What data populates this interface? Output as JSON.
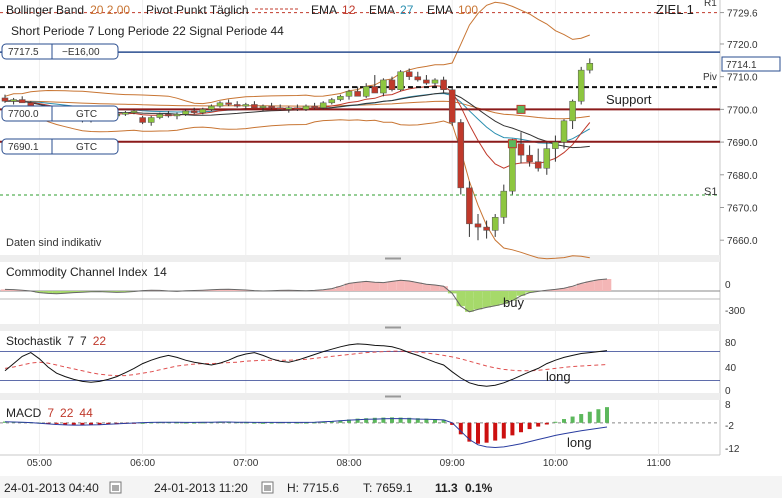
{
  "header": {
    "indicators": [
      {
        "name": "Bollinger Band",
        "params": "20  2.00",
        "color": "#c87533"
      },
      {
        "name": "Pivot Punkt  Täglich",
        "params": "",
        "color": "#c0392b"
      },
      {
        "name": "EMA",
        "params": "12",
        "color": "#c0392b"
      },
      {
        "name": "EMA",
        "params": "27",
        "color": "#2a8fb0"
      },
      {
        "name": "EMA",
        "params": "100",
        "color": "#c87533"
      }
    ],
    "target_label": "ZIEL 1",
    "trend_line": "Short Periode  7    Long Periode  22    Signal Periode  44",
    "disclaimer": "Daten sind indikativ"
  },
  "orders": [
    {
      "price": "7717.5",
      "action": "−E16,00",
      "color": "#2a4d8f"
    },
    {
      "price": "7700.0",
      "action": "GTC",
      "color": "#2a4d8f"
    },
    {
      "price": "7690.1",
      "action": "GTC",
      "color": "#2a4d8f"
    }
  ],
  "annotations": {
    "support": "Support",
    "buy": "buy",
    "long_stoch": "long",
    "long_macd": "long",
    "piv": "Piv",
    "s1": "S1",
    "r1": "R1",
    "last_price": "7714.1"
  },
  "panels": {
    "cci": {
      "title": "Commodity Channel Index",
      "param": "14",
      "ticks": [
        "0",
        "-300"
      ]
    },
    "stoch": {
      "title": "Stochastik",
      "params": [
        "7",
        "7",
        "22"
      ],
      "ticks": [
        "80",
        "40",
        "0"
      ]
    },
    "macd": {
      "title": "MACD",
      "params": [
        "7",
        "22",
        "44"
      ],
      "ticks": [
        "8",
        "-2",
        "-12"
      ]
    }
  },
  "footer": {
    "from": "24-01-2013 04:40",
    "to": "24-01-2013 11:20",
    "high": "H: 7715.6",
    "low": "T: 7659.1",
    "change": "11.3",
    "change_pct": "0.1%"
  },
  "chart_data": {
    "type": "candlestick",
    "x_ticks": [
      "05:00",
      "06:00",
      "07:00",
      "08:00",
      "09:00",
      "10:00",
      "11:00"
    ],
    "y_ticks": [
      7729.6,
      7720.0,
      7710.0,
      7700.0,
      7690.0,
      7680.0,
      7670.0,
      7660.0
    ],
    "ylim": [
      7657,
      7731
    ],
    "levels": {
      "r1": 7729.6,
      "order_high": 7717.5,
      "pivot": 7706.8,
      "support": 7700.0,
      "order_low": 7690.1,
      "s1": 7673.8
    },
    "candles": [
      {
        "t": "04:40",
        "o": 7703.5,
        "h": 7704.5,
        "l": 7702.0,
        "c": 7702.5
      },
      {
        "t": "04:45",
        "o": 7702.5,
        "h": 7703.5,
        "l": 7701.5,
        "c": 7703.0
      },
      {
        "t": "04:50",
        "o": 7703.0,
        "h": 7704.0,
        "l": 7702.0,
        "c": 7702.0
      },
      {
        "t": "04:55",
        "o": 7702.0,
        "h": 7702.5,
        "l": 7700.0,
        "c": 7700.5
      },
      {
        "t": "05:00",
        "o": 7700.5,
        "h": 7701.0,
        "l": 7698.5,
        "c": 7699.5
      },
      {
        "t": "05:05",
        "o": 7699.5,
        "h": 7700.5,
        "l": 7698.0,
        "c": 7698.5
      },
      {
        "t": "05:10",
        "o": 7698.5,
        "h": 7699.5,
        "l": 7697.5,
        "c": 7698.0
      },
      {
        "t": "05:15",
        "o": 7698.0,
        "h": 7699.0,
        "l": 7697.0,
        "c": 7697.5
      },
      {
        "t": "05:20",
        "o": 7697.5,
        "h": 7698.5,
        "l": 7696.5,
        "c": 7697.0
      },
      {
        "t": "05:25",
        "o": 7697.0,
        "h": 7698.0,
        "l": 7696.0,
        "c": 7696.5
      },
      {
        "t": "05:30",
        "o": 7696.5,
        "h": 7697.5,
        "l": 7696.0,
        "c": 7697.0
      },
      {
        "t": "05:35",
        "o": 7697.0,
        "h": 7698.0,
        "l": 7696.5,
        "c": 7697.5
      },
      {
        "t": "05:40",
        "o": 7697.5,
        "h": 7698.5,
        "l": 7697.0,
        "c": 7698.0
      },
      {
        "t": "05:45",
        "o": 7698.0,
        "h": 7699.0,
        "l": 7697.5,
        "c": 7698.5
      },
      {
        "t": "05:50",
        "o": 7698.5,
        "h": 7699.5,
        "l": 7698.0,
        "c": 7699.0
      },
      {
        "t": "05:55",
        "o": 7699.0,
        "h": 7700.0,
        "l": 7698.5,
        "c": 7699.5
      },
      {
        "t": "06:00",
        "o": 7697.5,
        "h": 7698.0,
        "l": 7695.5,
        "c": 7696.0
      },
      {
        "t": "06:05",
        "o": 7696.0,
        "h": 7698.0,
        "l": 7695.0,
        "c": 7697.5
      },
      {
        "t": "06:10",
        "o": 7697.5,
        "h": 7699.0,
        "l": 7697.0,
        "c": 7698.5
      },
      {
        "t": "06:15",
        "o": 7698.5,
        "h": 7699.5,
        "l": 7697.5,
        "c": 7698.0
      },
      {
        "t": "06:20",
        "o": 7698.0,
        "h": 7699.0,
        "l": 7697.0,
        "c": 7698.5
      },
      {
        "t": "06:25",
        "o": 7698.5,
        "h": 7700.0,
        "l": 7698.0,
        "c": 7699.5
      },
      {
        "t": "06:30",
        "o": 7699.5,
        "h": 7700.5,
        "l": 7698.5,
        "c": 7699.0
      },
      {
        "t": "06:35",
        "o": 7699.0,
        "h": 7700.5,
        "l": 7698.5,
        "c": 7700.0
      },
      {
        "t": "06:40",
        "o": 7700.0,
        "h": 7701.5,
        "l": 7699.5,
        "c": 7701.0
      },
      {
        "t": "06:45",
        "o": 7701.0,
        "h": 7702.5,
        "l": 7700.5,
        "c": 7702.0
      },
      {
        "t": "06:50",
        "o": 7702.0,
        "h": 7703.0,
        "l": 7701.0,
        "c": 7701.5
      },
      {
        "t": "06:55",
        "o": 7701.5,
        "h": 7702.5,
        "l": 7700.5,
        "c": 7701.0
      },
      {
        "t": "07:00",
        "o": 7701.0,
        "h": 7702.0,
        "l": 7700.0,
        "c": 7701.5
      },
      {
        "t": "07:05",
        "o": 7701.5,
        "h": 7702.5,
        "l": 7700.5,
        "c": 7700.5
      },
      {
        "t": "07:10",
        "o": 7700.5,
        "h": 7701.5,
        "l": 7699.5,
        "c": 7701.0
      },
      {
        "t": "07:15",
        "o": 7701.0,
        "h": 7702.0,
        "l": 7700.0,
        "c": 7700.5
      },
      {
        "t": "07:20",
        "o": 7700.5,
        "h": 7701.5,
        "l": 7699.5,
        "c": 7700.0
      },
      {
        "t": "07:25",
        "o": 7700.0,
        "h": 7701.0,
        "l": 7699.0,
        "c": 7700.5
      },
      {
        "t": "07:30",
        "o": 7700.5,
        "h": 7701.5,
        "l": 7699.5,
        "c": 7700.0
      },
      {
        "t": "07:35",
        "o": 7700.0,
        "h": 7701.5,
        "l": 7699.5,
        "c": 7701.0
      },
      {
        "t": "07:40",
        "o": 7701.0,
        "h": 7702.0,
        "l": 7700.0,
        "c": 7700.5
      },
      {
        "t": "07:45",
        "o": 7700.5,
        "h": 7702.5,
        "l": 7700.0,
        "c": 7702.0
      },
      {
        "t": "07:50",
        "o": 7702.0,
        "h": 7703.5,
        "l": 7701.5,
        "c": 7703.0
      },
      {
        "t": "07:55",
        "o": 7703.0,
        "h": 7704.5,
        "l": 7702.5,
        "c": 7704.0
      },
      {
        "t": "08:00",
        "o": 7704.0,
        "h": 7706.0,
        "l": 7703.0,
        "c": 7705.5
      },
      {
        "t": "08:05",
        "o": 7705.5,
        "h": 7707.0,
        "l": 7704.5,
        "c": 7704.0
      },
      {
        "t": "08:10",
        "o": 7704.0,
        "h": 7708.0,
        "l": 7703.5,
        "c": 7707.0
      },
      {
        "t": "08:15",
        "o": 7707.0,
        "h": 7710.5,
        "l": 7706.0,
        "c": 7705.0
      },
      {
        "t": "08:20",
        "o": 7705.0,
        "h": 7709.5,
        "l": 7704.0,
        "c": 7709.0
      },
      {
        "t": "08:25",
        "o": 7709.0,
        "h": 7710.0,
        "l": 7705.5,
        "c": 7706.0
      },
      {
        "t": "08:30",
        "o": 7706.0,
        "h": 7712.0,
        "l": 7705.5,
        "c": 7711.5
      },
      {
        "t": "08:35",
        "o": 7711.5,
        "h": 7712.5,
        "l": 7709.0,
        "c": 7710.0
      },
      {
        "t": "08:40",
        "o": 7710.0,
        "h": 7711.5,
        "l": 7708.5,
        "c": 7709.0
      },
      {
        "t": "08:45",
        "o": 7709.0,
        "h": 7710.5,
        "l": 7707.5,
        "c": 7708.0
      },
      {
        "t": "08:50",
        "o": 7708.0,
        "h": 7709.5,
        "l": 7707.0,
        "c": 7709.0
      },
      {
        "t": "08:55",
        "o": 7709.0,
        "h": 7710.0,
        "l": 7705.0,
        "c": 7706.0
      },
      {
        "t": "09:00",
        "o": 7706.0,
        "h": 7707.0,
        "l": 7695.0,
        "c": 7696.0
      },
      {
        "t": "09:05",
        "o": 7696.0,
        "h": 7697.0,
        "l": 7674.0,
        "c": 7676.0
      },
      {
        "t": "09:10",
        "o": 7676.0,
        "h": 7678.0,
        "l": 7661.0,
        "c": 7665.0
      },
      {
        "t": "09:15",
        "o": 7665.0,
        "h": 7668.0,
        "l": 7660.0,
        "c": 7664.0
      },
      {
        "t": "09:20",
        "o": 7664.0,
        "h": 7666.0,
        "l": 7660.5,
        "c": 7663.0
      },
      {
        "t": "09:25",
        "o": 7663.0,
        "h": 7668.0,
        "l": 7661.0,
        "c": 7667.0
      },
      {
        "t": "09:30",
        "o": 7667.0,
        "h": 7677.0,
        "l": 7665.0,
        "c": 7675.0
      },
      {
        "t": "09:35",
        "o": 7675.0,
        "h": 7691.0,
        "l": 7674.0,
        "c": 7689.5
      },
      {
        "t": "09:40",
        "o": 7689.5,
        "h": 7693.0,
        "l": 7683.5,
        "c": 7686.0
      },
      {
        "t": "09:45",
        "o": 7686.0,
        "h": 7689.0,
        "l": 7682.5,
        "c": 7684.0
      },
      {
        "t": "09:50",
        "o": 7684.0,
        "h": 7688.0,
        "l": 7681.0,
        "c": 7682.0
      },
      {
        "t": "09:55",
        "o": 7682.0,
        "h": 7690.0,
        "l": 7680.0,
        "c": 7688.0
      },
      {
        "t": "10:00",
        "o": 7688.0,
        "h": 7692.0,
        "l": 7684.0,
        "c": 7690.0
      },
      {
        "t": "10:05",
        "o": 7690.0,
        "h": 7697.0,
        "l": 7688.0,
        "c": 7696.5
      },
      {
        "t": "10:10",
        "o": 7696.5,
        "h": 7703.0,
        "l": 7694.0,
        "c": 7702.5
      },
      {
        "t": "10:15",
        "o": 7702.5,
        "h": 7713.0,
        "l": 7701.5,
        "c": 7712.0
      },
      {
        "t": "10:20",
        "o": 7712.0,
        "h": 7715.6,
        "l": 7711.0,
        "c": 7714.1
      }
    ],
    "cci": [
      20,
      18,
      10,
      0,
      -20,
      -30,
      -35,
      -28,
      -20,
      -15,
      -10,
      -8,
      -12,
      -18,
      -14,
      -6,
      5,
      10,
      8,
      0,
      -5,
      2,
      6,
      10,
      15,
      20,
      22,
      18,
      12,
      5,
      0,
      4,
      8,
      10,
      6,
      3,
      8,
      15,
      30,
      60,
      95,
      110,
      120,
      110,
      105,
      120,
      135,
      125,
      105,
      85,
      75,
      60,
      -30,
      -190,
      -260,
      -230,
      -205,
      -185,
      -160,
      -120,
      -60,
      -20,
      -5,
      10,
      20,
      35,
      60,
      95,
      120,
      140,
      150
    ],
    "stoch_k": [
      40,
      55,
      70,
      78,
      65,
      48,
      35,
      28,
      22,
      18,
      16,
      18,
      22,
      28,
      36,
      45,
      55,
      62,
      68,
      72,
      68,
      62,
      58,
      55,
      52,
      56,
      62,
      70,
      75,
      78,
      72,
      65,
      60,
      58,
      62,
      68,
      74,
      80,
      85,
      90,
      94,
      96,
      95,
      93,
      92,
      90,
      85,
      78,
      72,
      65,
      58,
      52,
      38,
      25,
      15,
      10,
      8,
      10,
      15,
      22,
      30,
      38,
      45,
      55,
      62,
      68,
      72,
      76,
      78,
      80,
      82
    ],
    "stoch_d": [
      45,
      48,
      52,
      56,
      58,
      56,
      52,
      48,
      44,
      40,
      36,
      33,
      31,
      30,
      30,
      32,
      35,
      38,
      42,
      46,
      50,
      52,
      54,
      55,
      55,
      56,
      57,
      58,
      60,
      61,
      62,
      62,
      62,
      62,
      63,
      64,
      66,
      68,
      70,
      72,
      74,
      76,
      78,
      79,
      80,
      81,
      81,
      80,
      79,
      77,
      75,
      72,
      69,
      65,
      60,
      55,
      50,
      46,
      43,
      41,
      40,
      40,
      41,
      43,
      45,
      47,
      49,
      50,
      51,
      52,
      53
    ],
    "macd_hist": [
      0.6,
      0.5,
      0.4,
      0.3,
      0.1,
      -0.2,
      -0.5,
      -0.8,
      -1.0,
      -1.1,
      -1.0,
      -0.9,
      -0.8,
      -0.6,
      -0.4,
      -0.2,
      0.0,
      0.2,
      0.3,
      0.3,
      0.2,
      0.1,
      0.1,
      0.2,
      0.3,
      0.4,
      0.4,
      0.3,
      0.2,
      0.1,
      0.0,
      0.1,
      0.2,
      0.2,
      0.1,
      0.1,
      0.2,
      0.4,
      0.8,
      1.2,
      1.6,
      2.0,
      2.2,
      2.4,
      2.5,
      2.6,
      2.5,
      2.4,
      2.2,
      2.0,
      1.8,
      1.5,
      -1.0,
      -5.5,
      -9.0,
      -10.0,
      -9.5,
      -8.5,
      -7.5,
      -6.0,
      -4.5,
      -3.0,
      -1.8,
      -0.8,
      0.5,
      1.8,
      3.0,
      4.2,
      5.3,
      6.5,
      7.5
    ],
    "macd_line": [
      0.5,
      0.4,
      0.3,
      0.1,
      -0.2,
      -0.5,
      -0.8,
      -1.0,
      -1.1,
      -1.1,
      -1.0,
      -0.9,
      -0.7,
      -0.5,
      -0.3,
      -0.1,
      0.1,
      0.2,
      0.3,
      0.3,
      0.3,
      0.2,
      0.2,
      0.3,
      0.3,
      0.4,
      0.4,
      0.3,
      0.3,
      0.2,
      0.2,
      0.2,
      0.2,
      0.2,
      0.2,
      0.2,
      0.3,
      0.5,
      0.7,
      1.0,
      1.3,
      1.5,
      1.7,
      1.8,
      1.9,
      2.0,
      2.0,
      1.9,
      1.8,
      1.7,
      1.6,
      1.4,
      0.0,
      -4.0,
      -8.0,
      -10.5,
      -11.5,
      -11.8,
      -11.5,
      -10.8,
      -10.0,
      -9.0,
      -8.0,
      -7.0,
      -6.0,
      -5.2,
      -4.5,
      -3.8,
      -3.2,
      -2.6,
      -2.0
    ]
  }
}
